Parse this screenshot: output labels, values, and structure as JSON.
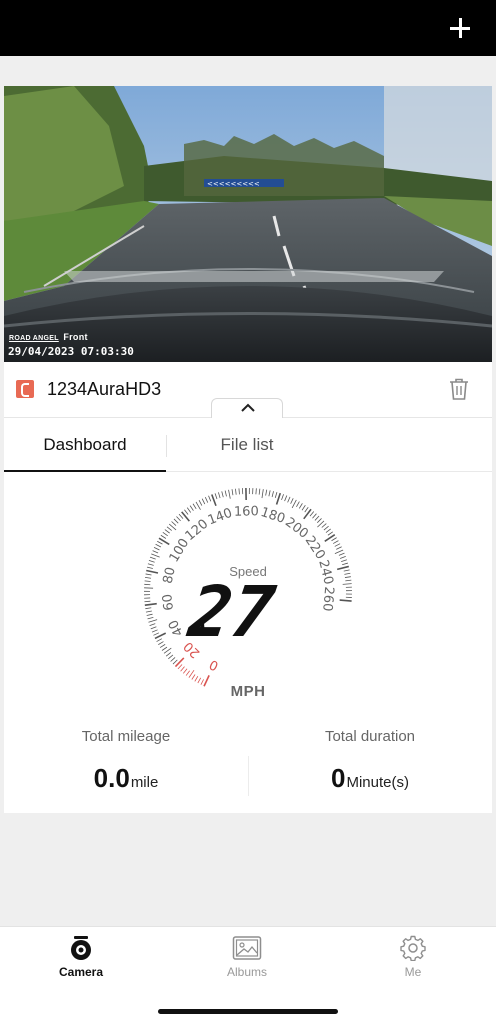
{
  "header": {
    "add_icon": "plus-icon"
  },
  "video": {
    "brand": "ROAD ANGEL",
    "camera": "Front",
    "timestamp": "29/04/2023 07:03:30"
  },
  "device": {
    "name": "1234AuraHD3",
    "icon": "device-icon",
    "delete_icon": "trash-icon",
    "collapse_icon": "chevron-up-icon"
  },
  "tabs": [
    {
      "label": "Dashboard",
      "active": true
    },
    {
      "label": "File list",
      "active": false
    }
  ],
  "speedometer": {
    "label": "Speed",
    "value": "27",
    "unit": "MPH",
    "scale_labels": [
      "0",
      "20",
      "40",
      "60",
      "80",
      "100",
      "120",
      "140",
      "160",
      "180",
      "200",
      "220",
      "240",
      "260"
    ],
    "min": 0,
    "max": 260,
    "needle_value": 27,
    "red_zone_max": 20,
    "red_color": "#d9534f"
  },
  "stats": {
    "mileage": {
      "title": "Total mileage",
      "value": "0.0",
      "unit": "mile"
    },
    "duration": {
      "title": "Total duration",
      "value": "0",
      "unit": "Minute(s)"
    }
  },
  "bottom_nav": [
    {
      "label": "Camera",
      "icon": "camera-icon",
      "active": true
    },
    {
      "label": "Albums",
      "icon": "albums-icon",
      "active": false
    },
    {
      "label": "Me",
      "icon": "gear-icon",
      "active": false
    }
  ]
}
